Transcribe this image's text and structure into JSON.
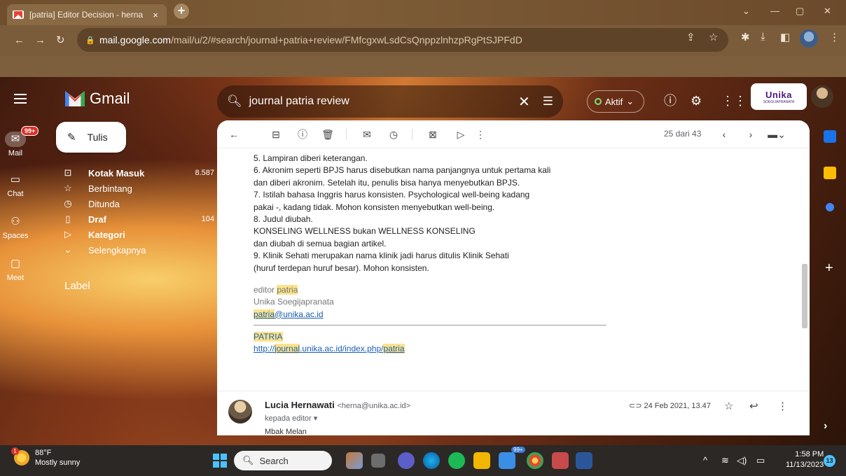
{
  "browser": {
    "tab_title": "[patria] Editor Decision - herna",
    "tab_close": "×",
    "new_tab": "+",
    "url_host": "mail.google.com",
    "url_path": "/mail/u/2/#search/journal+patria+review/FMfcgxwLsdCsQnppzlnhzpRgPtSJPFdD"
  },
  "gmail": {
    "app_name": "Gmail",
    "search_query": "journal patria review",
    "status": "Aktif",
    "brand_name": "Unika",
    "brand_sub": "SOEGIJAPRANATA"
  },
  "rail": [
    {
      "label": "Mail",
      "badge": "99+"
    },
    {
      "label": "Chat"
    },
    {
      "label": "Spaces"
    },
    {
      "label": "Meet"
    }
  ],
  "compose_label": "Tulis",
  "nav": [
    {
      "label": "Kotak Masuk",
      "count": "8.587",
      "icon": "inbox-icon"
    },
    {
      "label": "Berbintang",
      "count": "",
      "icon": "star-icon"
    },
    {
      "label": "Ditunda",
      "count": "",
      "icon": "clock-icon"
    },
    {
      "label": "Draf",
      "count": "104",
      "icon": "draft-icon"
    },
    {
      "label": "Kategori",
      "count": "",
      "icon": "label-icon"
    },
    {
      "label": "Selengkapnya",
      "count": "",
      "icon": "chevron-down-icon"
    }
  ],
  "label_header": "Label",
  "pager": "25 dari 43",
  "body_lines": [
    "5. Lampiran diberi keterangan.",
    "6. Akronim seperti BPJS harus disebutkan nama panjangnya untuk pertama kali",
    "dan diberi akronim. Setelah itu, penulis bisa hanya menyebutkan BPJS.",
    "7. Istilah bahasa Inggris harus konsisten. Psychological well-being kadang",
    "pakai -, kadang tidak. Mohon konsisten menyebutkan well-being.",
    "8. Judul diubah.",
    "KONSELING WELLNESS bukan WELLNESS KONSELING",
    "dan diubah di semua bagian artikel.",
    "9. Klinik Sehati merupakan nama klinik jadi harus ditulis Klinik Sehati",
    "(huruf terdepan huruf besar). Mohon konsisten."
  ],
  "signature": {
    "editor_prefix": "editor ",
    "editor_name": "patria",
    "institution": "Unika Soegijapranata",
    "email_user": "patria",
    "email_domain": "@unika.ac.id",
    "journal": "PATRIA",
    "link_a": "http://",
    "link_b": "journal",
    "link_c": ".unika.ac.id/index.php/",
    "link_d": "patria"
  },
  "next_message": {
    "sender": "Lucia Hernawati",
    "sender_email": "<herna@unika.ac.id>",
    "recipient": "kepada editor",
    "date": "24 Feb 2021, 13.47",
    "preview": "Mbak Melan"
  },
  "taskbar": {
    "temperature": "88°F",
    "weather": "Mostly sunny",
    "weather_badge": "1",
    "search_label": "Search",
    "app_badge": "99+",
    "time": "1:58 PM",
    "date": "11/13/2023",
    "notif_count": "13"
  }
}
